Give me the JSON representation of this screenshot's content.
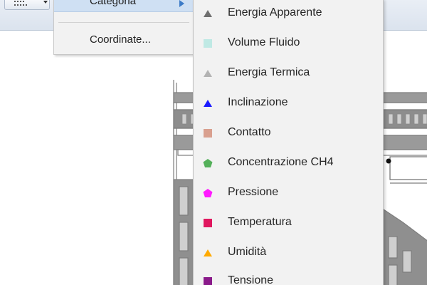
{
  "toolbar": {
    "tool_icon": "grid-icon",
    "dropdown_icon": "chevron-down-icon"
  },
  "menu": {
    "items": [
      {
        "label": "Categoria",
        "submenu_icon": "chevron-right-icon",
        "active": true
      },
      {
        "label": "Coordinate..."
      }
    ]
  },
  "submenu": {
    "categories": [
      {
        "label": "Energia Apparente",
        "icon": "triangle-icon",
        "color": "#6f6f6f"
      },
      {
        "label": "Volume Fluido",
        "icon": "square-icon",
        "color": "#bfe9e4"
      },
      {
        "label": "Energia Termica",
        "icon": "triangle-icon",
        "color": "#b3b3b3"
      },
      {
        "label": "Inclinazione",
        "icon": "triangle-icon",
        "color": "#1a1aff"
      },
      {
        "label": "Contatto",
        "icon": "square-icon",
        "color": "#d9a08f"
      },
      {
        "label": "Concentrazione CH4",
        "icon": "pentagon-icon",
        "color": "#54b05a"
      },
      {
        "label": "Pressione",
        "icon": "pentagon-icon",
        "color": "#ff1aff"
      },
      {
        "label": "Temperatura",
        "icon": "square-icon",
        "color": "#e0175f"
      },
      {
        "label": "Umidità",
        "icon": "triangle-icon",
        "color": "#ffaa00"
      },
      {
        "label": "Tensione",
        "icon": "square-icon",
        "color": "#8a1a8a"
      }
    ]
  }
}
